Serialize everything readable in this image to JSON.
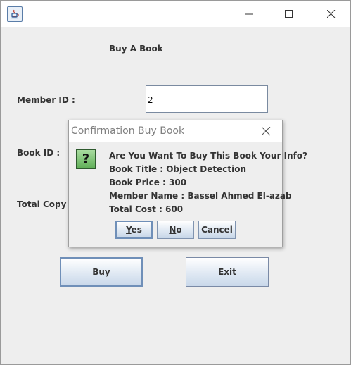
{
  "form": {
    "heading": "Buy A Book",
    "member_id_label": "Member ID :",
    "member_id_value": "2",
    "book_id_label": "Book ID :",
    "total_copy_label": "Total Copy :",
    "buy_label": "Buy",
    "exit_label": "Exit"
  },
  "dialog": {
    "title": "Confirmation Buy Book",
    "icon": "question-icon",
    "icon_glyph": "?",
    "lines": [
      "Are You Want To Buy This Book Your Info?",
      "Book Title : Object Detection",
      "Book Price : 300",
      "Member Name : Bassel Ahmed El-azab",
      "Total Cost : 600"
    ],
    "buttons": {
      "yes": {
        "mnemonic": "Y",
        "rest": "es"
      },
      "no": {
        "mnemonic": "N",
        "rest": "o"
      },
      "cancel": "Cancel"
    }
  }
}
